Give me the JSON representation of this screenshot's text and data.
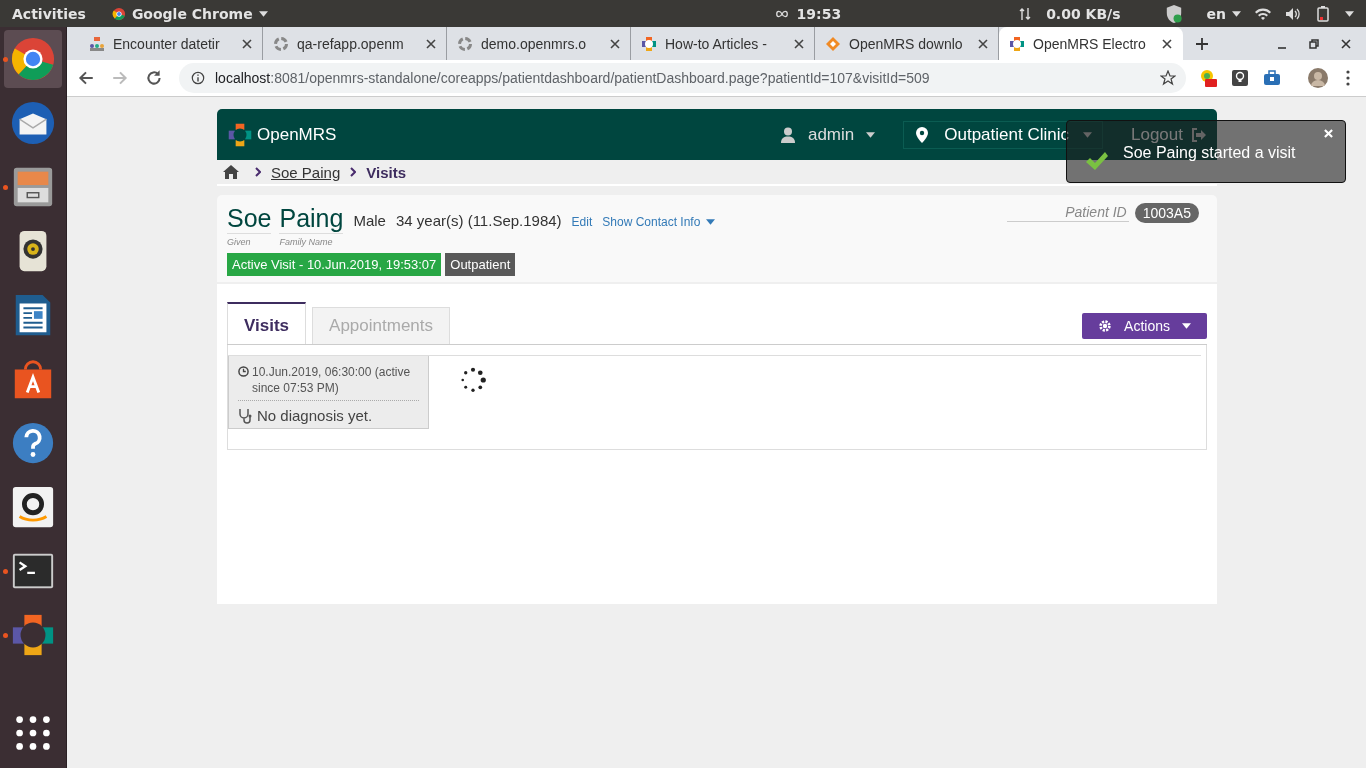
{
  "system_bar": {
    "activities": "Activities",
    "app_name": "Google Chrome",
    "clock": "19:53",
    "network_speed": "0.00 KB/s",
    "language": "en"
  },
  "dock": [
    {
      "kind": "chrome",
      "running": true,
      "selected": true
    },
    {
      "kind": "mail",
      "running": false,
      "selected": false
    },
    {
      "kind": "files",
      "running": true,
      "selected": false
    },
    {
      "kind": "speaker",
      "running": false,
      "selected": false
    },
    {
      "kind": "writer",
      "running": false,
      "selected": false
    },
    {
      "kind": "store",
      "running": false,
      "selected": false
    },
    {
      "kind": "help",
      "running": false,
      "selected": false
    },
    {
      "kind": "amazon",
      "running": false,
      "selected": false
    },
    {
      "kind": "terminal",
      "running": true,
      "selected": false
    },
    {
      "kind": "openmrs",
      "running": true,
      "selected": false
    },
    {
      "kind": "apps",
      "running": false,
      "selected": false
    }
  ],
  "browser_tabs": [
    {
      "title": "Encounter datetir",
      "kind": "people",
      "selected": false
    },
    {
      "title": "qa-refapp.openm",
      "kind": "ring",
      "selected": false
    },
    {
      "title": "demo.openmrs.o",
      "kind": "ring",
      "selected": false
    },
    {
      "title": "How-to Articles -",
      "kind": "openmrs",
      "selected": false
    },
    {
      "title": "OpenMRS downlo",
      "kind": "diamond",
      "selected": false
    },
    {
      "title": "OpenMRS Electro",
      "kind": "openmrs",
      "selected": true
    }
  ],
  "address_bar": {
    "host": "localhost",
    "path": ":8081/openmrs-standalone/coreapps/patientdashboard/patientDashboard.page?patientId=107&visitId=509"
  },
  "header": {
    "brand": "OpenMRS",
    "user": "admin",
    "location": "Outpatient Clinic",
    "logout": "Logout"
  },
  "toast": {
    "message": "Soe Paing started a visit"
  },
  "breadcrumb": [
    {
      "label": "Soe Paing",
      "kind": "link"
    },
    {
      "label": "Visits",
      "kind": "current"
    }
  ],
  "patient": {
    "given": "Soe",
    "family": "Paing",
    "given_label": "Given",
    "family_label": "Family Name",
    "gender": "Male",
    "age": "34 year(s) (11.Sep.1984)",
    "edit": "Edit",
    "contact": "Show Contact Info",
    "id_label": "Patient ID",
    "id": "1003A5",
    "active_visit": "Active Visit - 10.Jun.2019, 19:53:07",
    "visit_type": "Outpatient"
  },
  "page_tabs": [
    {
      "label": "Visits",
      "selected": true
    },
    {
      "label": "Appointments",
      "selected": false
    }
  ],
  "actions": "Actions",
  "visits": [
    {
      "date": "10.Jun.2019, 06:30:00 (active since 07:53 PM)",
      "diagnosis": "No diagnosis yet."
    }
  ]
}
